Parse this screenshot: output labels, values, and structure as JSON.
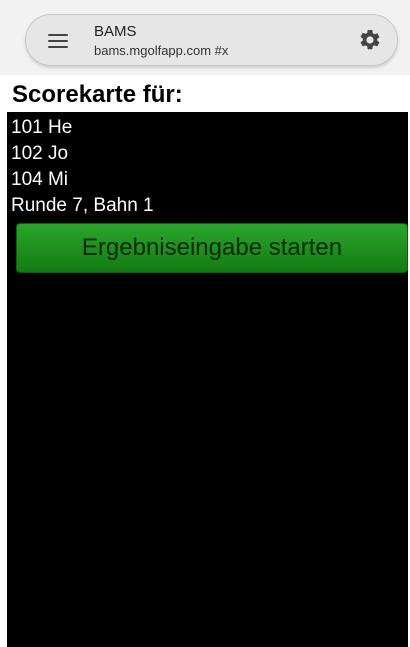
{
  "browser": {
    "page_title": "BAMS",
    "url": "bams.mgolfapp.com #x",
    "menu_icon": "hamburger-icon",
    "settings_icon": "gear-icon"
  },
  "scorecard": {
    "heading": "Scorekarte für:",
    "players": [
      "101 He",
      "102 Jo",
      "104 Mi"
    ],
    "round_info": "Runde 7, Bahn 1",
    "start_button_label": "Ergebniseingabe starten"
  },
  "colors": {
    "button_green": "#1f8f1f",
    "background": "#000000"
  }
}
